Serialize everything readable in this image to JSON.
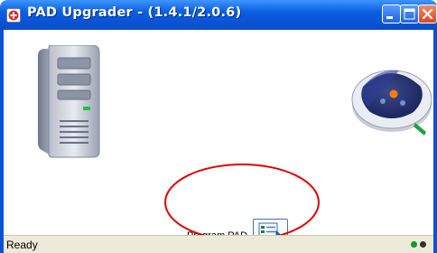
{
  "window": {
    "title": "PAD Upgrader - (1.4.1/2.0.6)",
    "icon": "app-icon"
  },
  "titlebar_buttons": {
    "minimize": "minimize-icon",
    "maximize": "maximize-icon",
    "close": "close-icon"
  },
  "main": {
    "program_label": "Program PAD",
    "program_button_icon": "program-arrow-icon",
    "computer_icon": "computer-tower-icon",
    "device_icon": "defibrillator-device-icon"
  },
  "status": {
    "text": "Ready",
    "indicator_colors": [
      "#0a9a2a",
      "#303030"
    ]
  },
  "annotation_color": "#e00000"
}
